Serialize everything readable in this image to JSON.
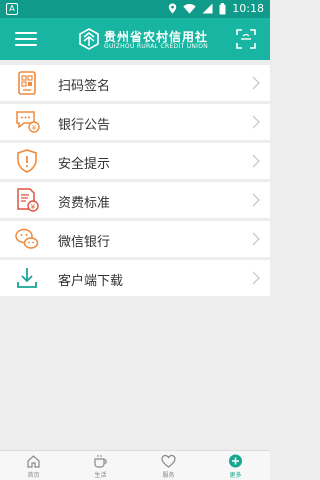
{
  "status_bar": {
    "left_icon": "A",
    "icons": [
      "location-icon",
      "wifi-icon",
      "signal-icon",
      "battery-icon"
    ],
    "time": "10:18"
  },
  "header": {
    "brand_cn": "贵州省农村信用社",
    "brand_en": "GUIZHOU RURAL CREDIT UNION",
    "menu_icon": "menu-icon",
    "scan_icon": "scan-icon"
  },
  "menu": {
    "items": [
      {
        "label": "扫码签名",
        "icon": "scan-sign-icon"
      },
      {
        "label": "银行公告",
        "icon": "announcement-icon"
      },
      {
        "label": "安全提示",
        "icon": "security-shield-icon"
      },
      {
        "label": "资费标准",
        "icon": "fee-standard-icon"
      },
      {
        "label": "微信银行",
        "icon": "wechat-icon"
      },
      {
        "label": "客户端下载",
        "icon": "download-icon"
      }
    ]
  },
  "tabs": [
    {
      "label": "首页",
      "icon": "home-icon",
      "active": false
    },
    {
      "label": "生活",
      "icon": "coffee-icon",
      "active": false
    },
    {
      "label": "服务",
      "icon": "heart-icon",
      "active": false
    },
    {
      "label": "更多",
      "icon": "plus-circle-icon",
      "active": true
    }
  ],
  "colors": {
    "header": "#18b6a2",
    "status_bar": "#0f9a89",
    "icon_orange": "#f08a3c",
    "active_tab": "#16a88f"
  }
}
